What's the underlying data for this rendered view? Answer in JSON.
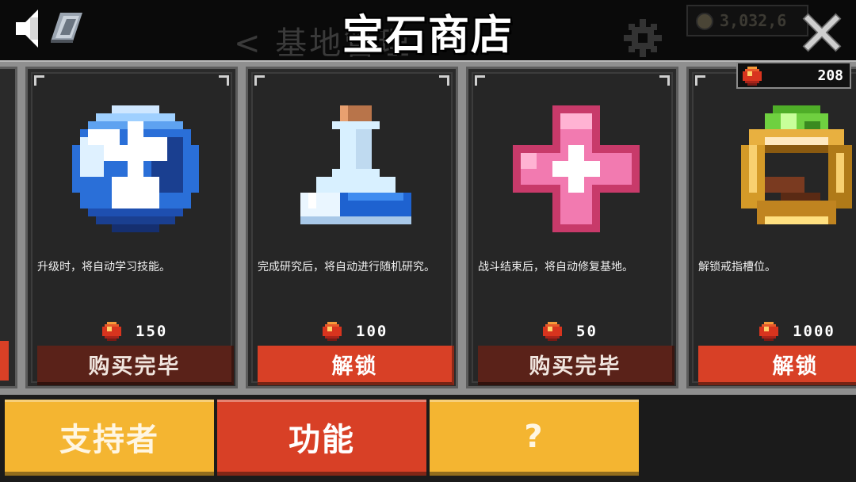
{
  "header": {
    "title": "宝石商店",
    "background_back_label": "< 基地管理",
    "background_coin_value": "3,032,6",
    "icons": [
      "speaker-icon",
      "book-icon",
      "close-icon",
      "gear-icon"
    ]
  },
  "gem_balance": "208",
  "items": [
    {
      "icon": "skill-orb-icon",
      "description": "升级时，将自动学习技能。",
      "price": "150",
      "button": "购买完毕",
      "state": "bought"
    },
    {
      "icon": "potion-flask-icon",
      "description": "完成研究后，将自动进行随机研究。",
      "price": "100",
      "button": "解锁",
      "state": "locked"
    },
    {
      "icon": "health-cross-icon",
      "description": "战斗结束后，将自动修复基地。",
      "price": "50",
      "button": "购买完毕",
      "state": "bought"
    },
    {
      "icon": "ring-icon",
      "description": "解锁戒指槽位。",
      "price": "1000",
      "button": "解锁",
      "state": "locked"
    }
  ],
  "tabs": [
    {
      "label": "支持者",
      "color": "#f4b531"
    },
    {
      "label": "功能",
      "color": "#d84026"
    },
    {
      "label": "?",
      "color": "#f4b531"
    }
  ],
  "colors": {
    "accent_red": "#d84026",
    "bought_brown": "#5a2219",
    "tab_yellow": "#f4b531",
    "panel_gray": "#8f8f8f"
  }
}
